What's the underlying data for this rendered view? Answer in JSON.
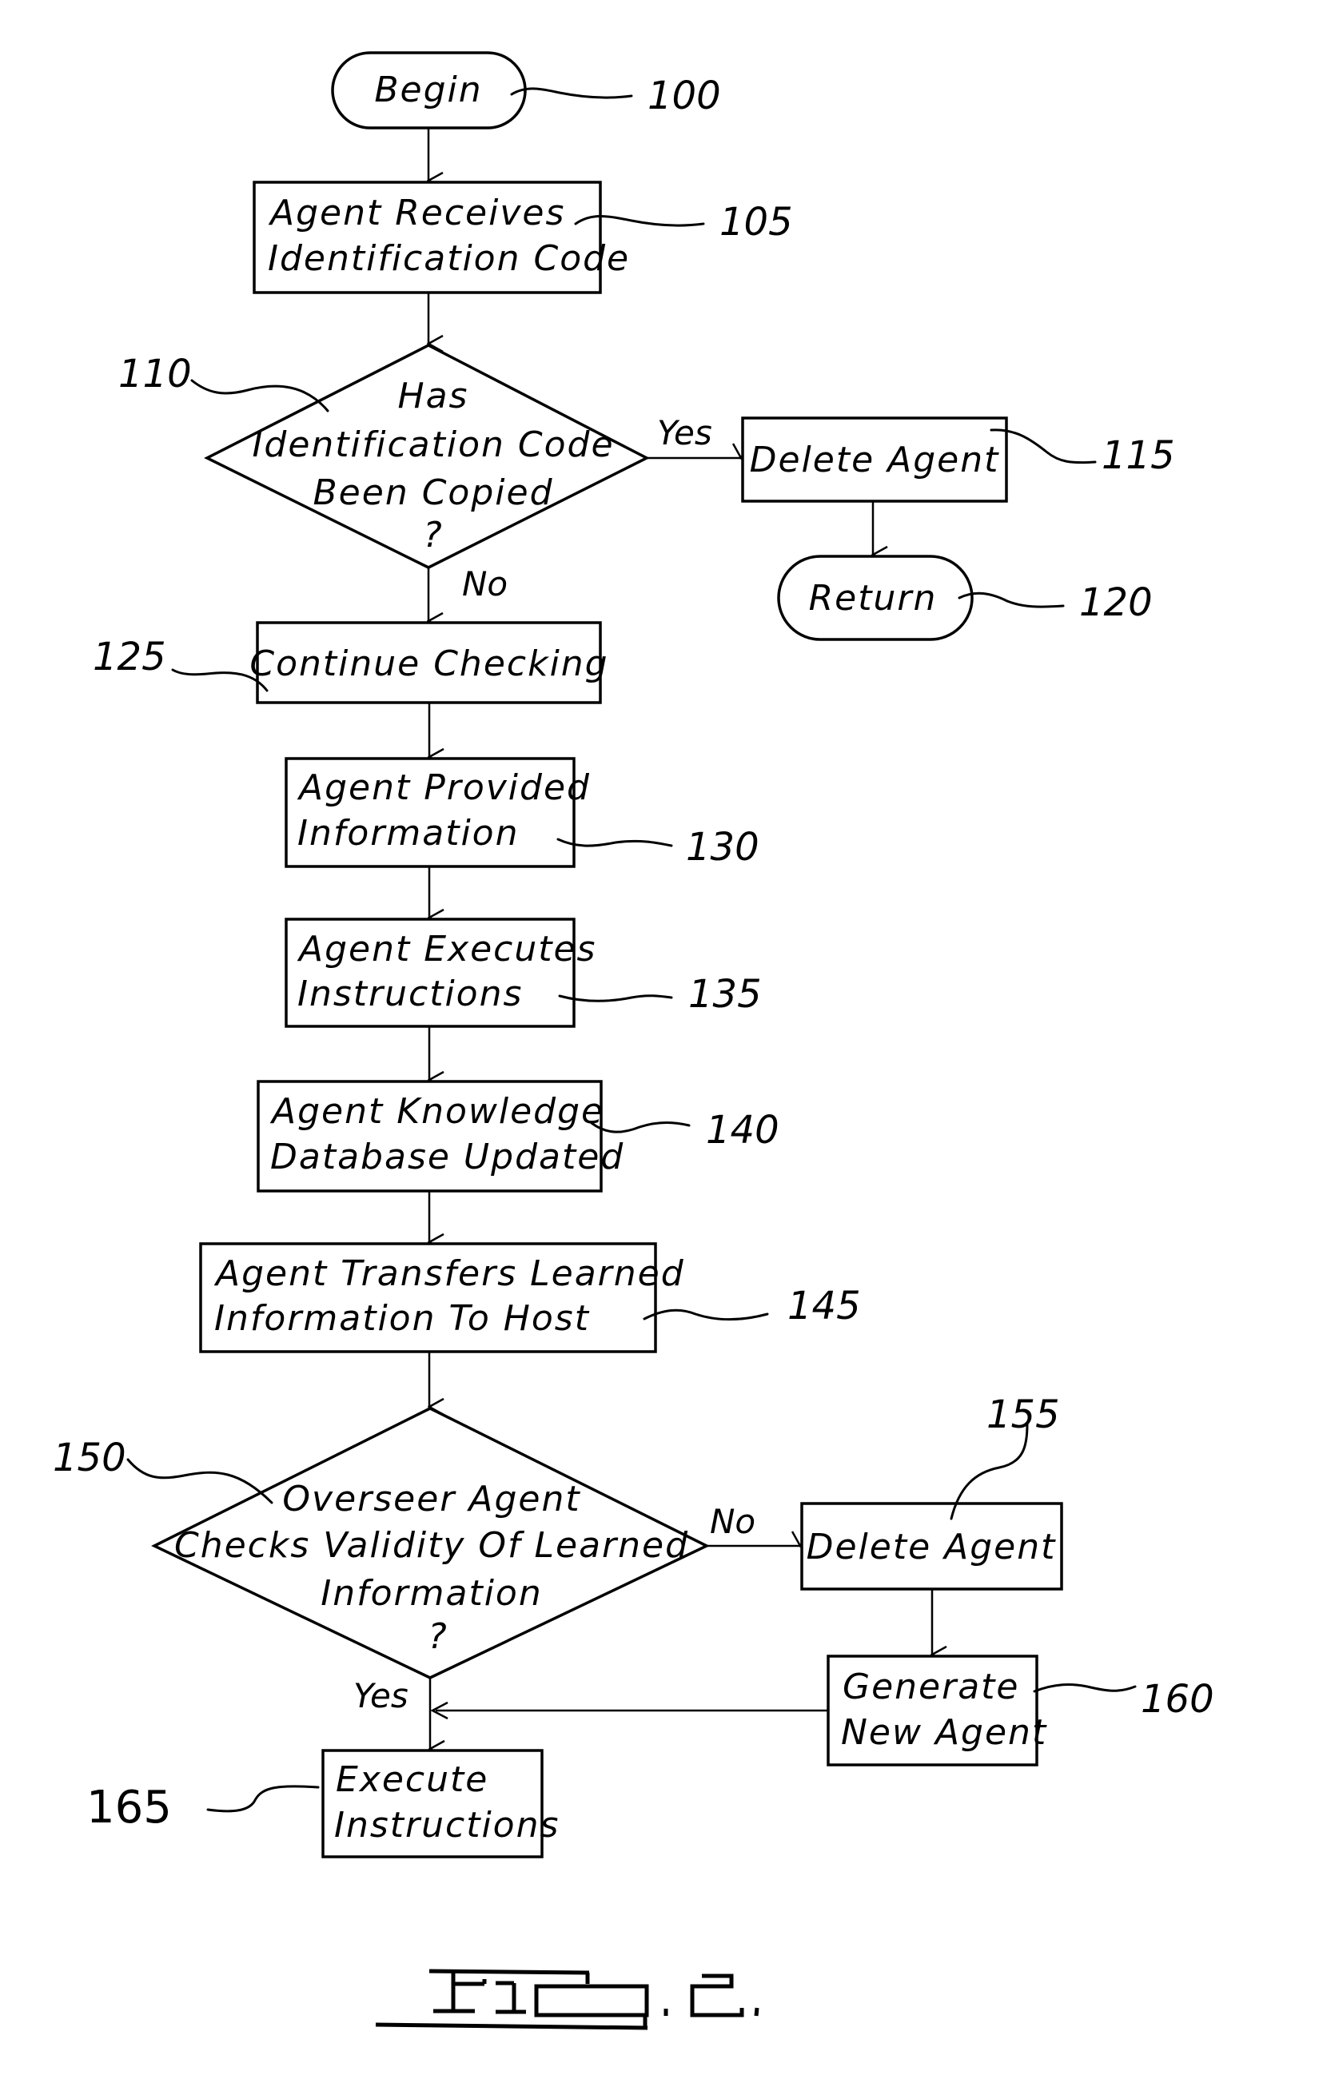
{
  "figure": {
    "title": "FIG. 2.",
    "nodes": [
      {
        "id": "100",
        "type": "terminal",
        "lines": [
          "Begin"
        ]
      },
      {
        "id": "105",
        "type": "process",
        "lines": [
          "Agent Receives",
          "Identification Code"
        ]
      },
      {
        "id": "110",
        "type": "decision",
        "lines": [
          "Has",
          "Identification Code",
          "Been Copied",
          "?"
        ]
      },
      {
        "id": "115",
        "type": "process",
        "lines": [
          "Delete Agent"
        ]
      },
      {
        "id": "120",
        "type": "terminal",
        "lines": [
          "Return"
        ]
      },
      {
        "id": "125",
        "type": "process",
        "lines": [
          "Continue Checking"
        ]
      },
      {
        "id": "130",
        "type": "process",
        "lines": [
          "Agent Provided",
          "Information"
        ]
      },
      {
        "id": "135",
        "type": "process",
        "lines": [
          "Agent Executes",
          "Instructions"
        ]
      },
      {
        "id": "140",
        "type": "process",
        "lines": [
          "Agent Knowledge",
          "Database Updated"
        ]
      },
      {
        "id": "145",
        "type": "process",
        "lines": [
          "Agent Transfers Learned",
          "Information To Host"
        ]
      },
      {
        "id": "150",
        "type": "decision",
        "lines": [
          "Overseer Agent",
          "Checks Validity Of Learned",
          "Information",
          "?"
        ]
      },
      {
        "id": "155",
        "type": "process",
        "lines": [
          "Delete Agent"
        ]
      },
      {
        "id": "160",
        "type": "process",
        "lines": [
          "Generate",
          "New Agent"
        ]
      },
      {
        "id": "165",
        "type": "process",
        "lines": [
          "Execute",
          "Instructions"
        ]
      }
    ],
    "ref_labels": {
      "n100": "100",
      "n105": "105",
      "n110": "110",
      "n115": "115",
      "n120": "120",
      "n125": "125",
      "n130": "130",
      "n135": "135",
      "n140": "140",
      "n145": "145",
      "n150": "150",
      "n155": "155",
      "n160": "160",
      "n165": "165"
    },
    "edges": [
      {
        "from": "100",
        "to": "105",
        "label": ""
      },
      {
        "from": "105",
        "to": "110",
        "label": ""
      },
      {
        "from": "110",
        "to": "115",
        "label": "Yes"
      },
      {
        "from": "115",
        "to": "120",
        "label": ""
      },
      {
        "from": "110",
        "to": "125",
        "label": "No"
      },
      {
        "from": "125",
        "to": "130",
        "label": ""
      },
      {
        "from": "130",
        "to": "135",
        "label": ""
      },
      {
        "from": "135",
        "to": "140",
        "label": ""
      },
      {
        "from": "140",
        "to": "145",
        "label": ""
      },
      {
        "from": "145",
        "to": "150",
        "label": ""
      },
      {
        "from": "150",
        "to": "155",
        "label": "No"
      },
      {
        "from": "155",
        "to": "160",
        "label": ""
      },
      {
        "from": "160",
        "to": "165",
        "label": ""
      },
      {
        "from": "150",
        "to": "165",
        "label": "Yes"
      }
    ],
    "edge_labels": {
      "yes_110": "Yes",
      "no_110": "No",
      "no_150": "No",
      "yes_150": "Yes"
    }
  }
}
